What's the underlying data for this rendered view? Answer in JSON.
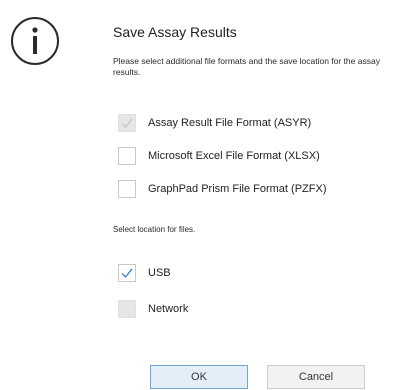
{
  "dialog": {
    "title": "Save Assay Results",
    "description": "Please select additional file formats and the save location for the assay results.",
    "icon": "info-icon"
  },
  "formats": [
    {
      "label": "Assay Result File Format (ASYR)",
      "checked": true,
      "disabled": true
    },
    {
      "label": "Microsoft Excel File Format (XLSX)",
      "checked": false,
      "disabled": false
    },
    {
      "label": "GraphPad Prism File Format (PZFX)",
      "checked": false,
      "disabled": false
    }
  ],
  "location": {
    "label": "Select location for files.",
    "options": [
      {
        "label": "USB",
        "checked": true,
        "disabled": false
      },
      {
        "label": "Network",
        "checked": false,
        "disabled": true
      }
    ]
  },
  "buttons": {
    "ok_label": "OK",
    "cancel_label": "Cancel"
  },
  "colors": {
    "check_enabled": "#4a86c6",
    "check_disabled": "#c8c8c8",
    "ok_border": "#6fa6d6",
    "ok_background": "#e3eef8"
  }
}
